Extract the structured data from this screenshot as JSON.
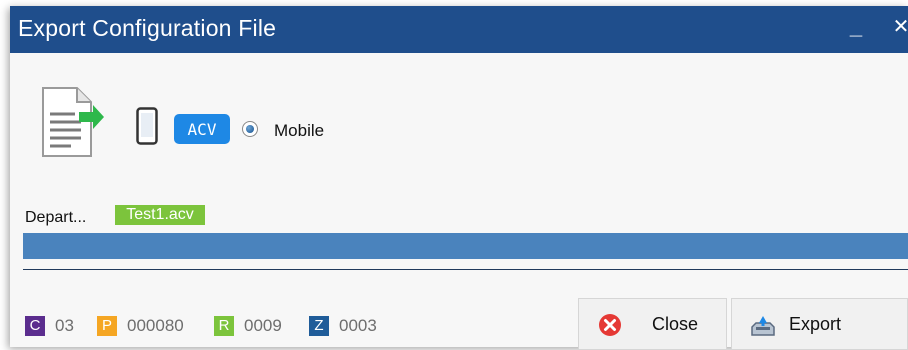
{
  "window": {
    "title": "Export Configuration File",
    "minimize_glyph": "_",
    "close_glyph": "✕"
  },
  "mode": {
    "badge_label": "ACV",
    "option_label": "Mobile",
    "option_selected": true
  },
  "transfer": {
    "department_label": "Depart...",
    "file_name": "Test1.acv",
    "progress": 1.0
  },
  "counters": [
    {
      "letter": "C",
      "value": "03",
      "color": "#5b2d8e"
    },
    {
      "letter": "P",
      "value": "000080",
      "color": "#f5a623"
    },
    {
      "letter": "R",
      "value": "0009",
      "color": "#7cc43c"
    },
    {
      "letter": "Z",
      "value": "0003",
      "color": "#1f5c99"
    }
  ],
  "buttons": {
    "close_label": "Close",
    "export_label": "Export"
  },
  "colors": {
    "titlebar": "#1f4e8c",
    "accent_badge": "#1e88e5",
    "progress": "#4a83bd",
    "file_tag": "#7cc43c"
  },
  "icons": {
    "document": "export-document-icon",
    "device": "mobile-phone-icon",
    "close": "close-circle-icon",
    "export": "export-tray-icon"
  }
}
